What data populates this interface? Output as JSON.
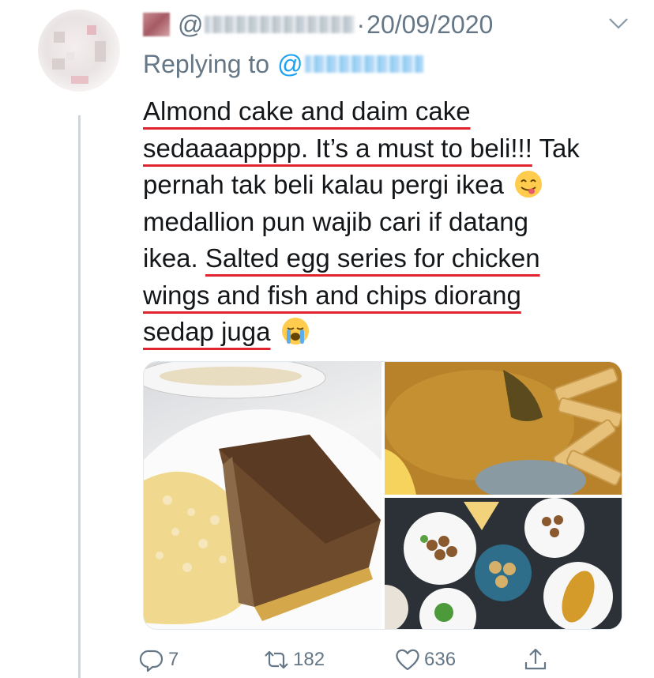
{
  "tweet": {
    "handle_prefix": "@",
    "date_separator": "·",
    "date": "20/09/2020",
    "reply_prefix": "Replying to",
    "reply_at": "@",
    "lines": [
      "Almond cake and daim cake",
      "sedaaaapppp. It’s a must to beli!!!",
      " Tak",
      "pernah tak beli kalau pergi ikea",
      "medallion pun wajib cari if datang",
      "ikea.",
      "Salted egg series for chicken",
      "wings and fish and chips diorang",
      "sedap juga"
    ],
    "emojis": [
      "face-savoring-food-emoji",
      "loudly-crying-face-emoji"
    ],
    "media_alts": [
      "almond cake and daim cake slice",
      "salted egg fish and chips",
      "table of ikea meals"
    ],
    "actions": {
      "replies": "7",
      "retweets": "182",
      "likes": "636"
    }
  },
  "colors": {
    "secondary_text": "#657786",
    "link": "#1da1f2",
    "underline": "#e0242f",
    "thread_line": "#ccd6dd"
  }
}
